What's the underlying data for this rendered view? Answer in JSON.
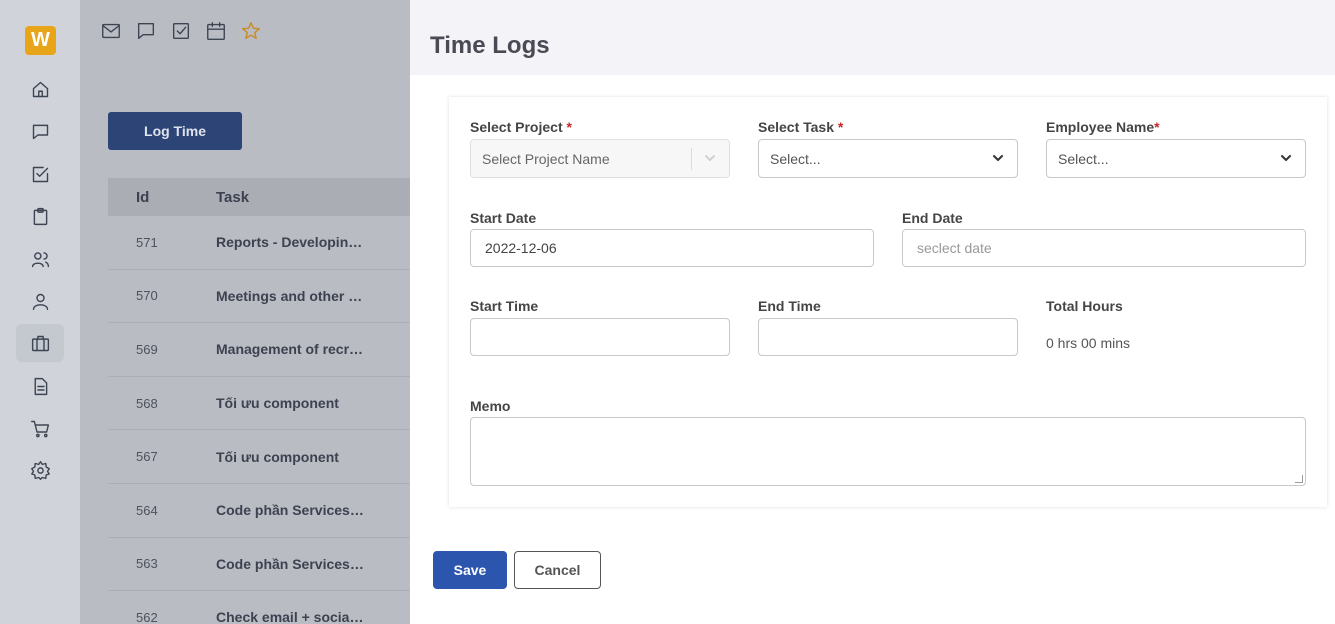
{
  "app": {
    "logo_letter": "W"
  },
  "sidebar": {
    "items": [
      {
        "icon": "home-icon"
      },
      {
        "icon": "chat-icon"
      },
      {
        "icon": "task-check-icon"
      },
      {
        "icon": "clipboard-icon"
      },
      {
        "icon": "users-icon"
      },
      {
        "icon": "user-icon"
      },
      {
        "icon": "briefcase-icon",
        "active": true
      },
      {
        "icon": "document-icon"
      },
      {
        "icon": "cart-icon"
      },
      {
        "icon": "settings-icon"
      }
    ]
  },
  "toolbar": {
    "icons": [
      "mail-icon",
      "chat-icon",
      "task-check-icon",
      "calendar-icon",
      "star-icon"
    ]
  },
  "page": {
    "log_time_label": "Log Time",
    "table": {
      "headers": {
        "id": "Id",
        "task": "Task"
      },
      "rows": [
        {
          "id": "571",
          "task": "Reports - Developing ..."
        },
        {
          "id": "570",
          "task": "Meetings and other w..."
        },
        {
          "id": "569",
          "task": "Management of recru..."
        },
        {
          "id": "568",
          "task": "Tối ưu component"
        },
        {
          "id": "567",
          "task": "Tối ưu component"
        },
        {
          "id": "564",
          "task": "Code phần Services C..."
        },
        {
          "id": "563",
          "task": "Code phần Services C..."
        },
        {
          "id": "562",
          "task": "Check email + social ..."
        }
      ]
    }
  },
  "drawer": {
    "title": "Time Logs",
    "form": {
      "project_label": "Select Project",
      "project_placeholder": "Select Project Name",
      "task_label": "Select Task",
      "task_placeholder": "Select...",
      "employee_label": "Employee Name",
      "employee_placeholder": "Select...",
      "required_mark": "*",
      "start_date_label": "Start Date",
      "start_date_value": "2022-12-06",
      "end_date_label": "End Date",
      "end_date_placeholder": "seclect date",
      "start_time_label": "Start Time",
      "start_time_value": "",
      "end_time_label": "End Time",
      "end_time_value": "",
      "total_hours_label": "Total Hours",
      "total_hours_value": "0 hrs 00 mins",
      "memo_label": "Memo",
      "memo_value": ""
    },
    "save_label": "Save",
    "cancel_label": "Cancel"
  },
  "colors": {
    "primary": "#2c55ae",
    "logo": "#e8a51a",
    "required": "#c62828"
  }
}
